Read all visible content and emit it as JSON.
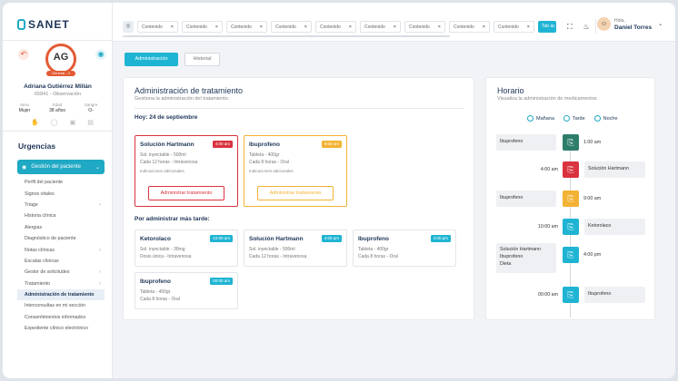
{
  "app": {
    "logo": "SANET"
  },
  "patient": {
    "initials": "AG",
    "badge": "General - 2",
    "name": "Adriana Gutiérrez Millán",
    "id_line": "65841 - Observación",
    "stats": [
      {
        "label": "Sexo",
        "value": "Mujer"
      },
      {
        "label": "Edad",
        "value": "38 años"
      },
      {
        "label": "Sangre",
        "value": "O-"
      }
    ]
  },
  "sidebar": {
    "section": "Urgencias",
    "main_item": "Gestión del paciente",
    "items": [
      {
        "label": "Perfil del paciente",
        "chevron": false,
        "active": false
      },
      {
        "label": "Signos vitales",
        "chevron": false,
        "active": false
      },
      {
        "label": "Triage",
        "chevron": true,
        "active": false
      },
      {
        "label": "Historia clínica",
        "chevron": false,
        "active": false
      },
      {
        "label": "Alergias",
        "chevron": false,
        "active": false
      },
      {
        "label": "Diagnóstico de paciente",
        "chevron": false,
        "active": false
      },
      {
        "label": "Notas clínicas",
        "chevron": true,
        "active": false
      },
      {
        "label": "Escalas clínicas",
        "chevron": false,
        "active": false
      },
      {
        "label": "Gestor de solicitudes",
        "chevron": true,
        "active": false
      },
      {
        "label": "Tratamiento",
        "chevron": true,
        "active": false
      },
      {
        "label": "Administración de tratamiento",
        "chevron": false,
        "active": true
      },
      {
        "label": "Interconsultas en mi sección",
        "chevron": false,
        "active": false
      },
      {
        "label": "Consentimientos informados",
        "chevron": false,
        "active": false
      },
      {
        "label": "Expediente clínico electrónico",
        "chevron": false,
        "active": false
      }
    ]
  },
  "topbar": {
    "tabs": [
      "Contenido",
      "Contenido",
      "Contenido",
      "Contenido",
      "Contenido",
      "Contenido",
      "Contenido",
      "Contenido",
      "Contenido"
    ],
    "active_tab": "Tab ac",
    "greeting": "Hola,",
    "user_name": "Daniel Torres"
  },
  "view_tabs": {
    "active": "Administración",
    "inactive": "Historial"
  },
  "main": {
    "title": "Administración de tratamiento",
    "subtitle": "Gestiona la administración del tratamiento.",
    "date_label": "Hoy: 24 de septiembre",
    "later_label": "Por administrar  más tarde:",
    "current": [
      {
        "name": "Solución Hartmann",
        "time": "4:00 am",
        "l1": "Sol. inyectable - 500ml",
        "l2": "Cada 12 horas - Intravenosa",
        "l3": "Indicaciones adicionales",
        "button": "Administrar tratamiento",
        "color": "#d9333f"
      },
      {
        "name": "Ibuprofeno",
        "time": "9:00 am",
        "l1": "Tableta - 400gr",
        "l2": "Cada 8 horas - Oral",
        "l3": "Indicaciones adicionales",
        "button": "Administrar tratamiento",
        "color": "#f2b233"
      }
    ],
    "later": [
      {
        "name": "Ketorolaco",
        "time": "10:00 am",
        "l1": "Sol. inyectable - 30mg",
        "l2": "Dosis única - Intravenosa"
      },
      {
        "name": "Solución Hartmann",
        "time": "4:00 pm",
        "l1": "Sol. inyectable - 500ml",
        "l2": "Cada 12 horas - Intravenosa"
      },
      {
        "name": "Ibuprofeno",
        "time": "4:00 pm",
        "l1": "Tableta - 400gr",
        "l2": "Cada 8 horas - Oral"
      },
      {
        "name": "Ibuprofeno",
        "time": "00:00 am",
        "l1": "Tableta - 400gr",
        "l2": "Cada 8 horas - Oral"
      }
    ]
  },
  "schedule": {
    "title": "Horario",
    "subtitle": "Visualiza la administración de medicamentos",
    "shifts": [
      "Mañana",
      "Tarde",
      "Noche"
    ],
    "entries": [
      {
        "side": "left",
        "text": "Ibuprofeno",
        "time": "1:00 am",
        "color": "#2e7d6b"
      },
      {
        "side": "right",
        "text": "Solución Hartmann",
        "time": "4:00 am",
        "color": "#d9333f"
      },
      {
        "side": "left",
        "text": "Ibuprofeno",
        "time": "9:00 am",
        "color": "#f2b233"
      },
      {
        "side": "right",
        "text": "Ketorolaco",
        "time": "10:00 am",
        "color": "#1fb4d3"
      },
      {
        "side": "left",
        "text": "Solución Hartmann\nIbuprofeno\nDieta",
        "time": "4:00 pm",
        "color": "#1fb4d3"
      },
      {
        "side": "right",
        "text": "Ibuprofeno",
        "time": "00:00 am",
        "color": "#1fb4d3"
      }
    ]
  },
  "colors": {
    "accent": "#1fb4d3",
    "red": "#d9333f",
    "yellow": "#f2b233",
    "green": "#2e7d6b",
    "navy": "#1d3557"
  }
}
